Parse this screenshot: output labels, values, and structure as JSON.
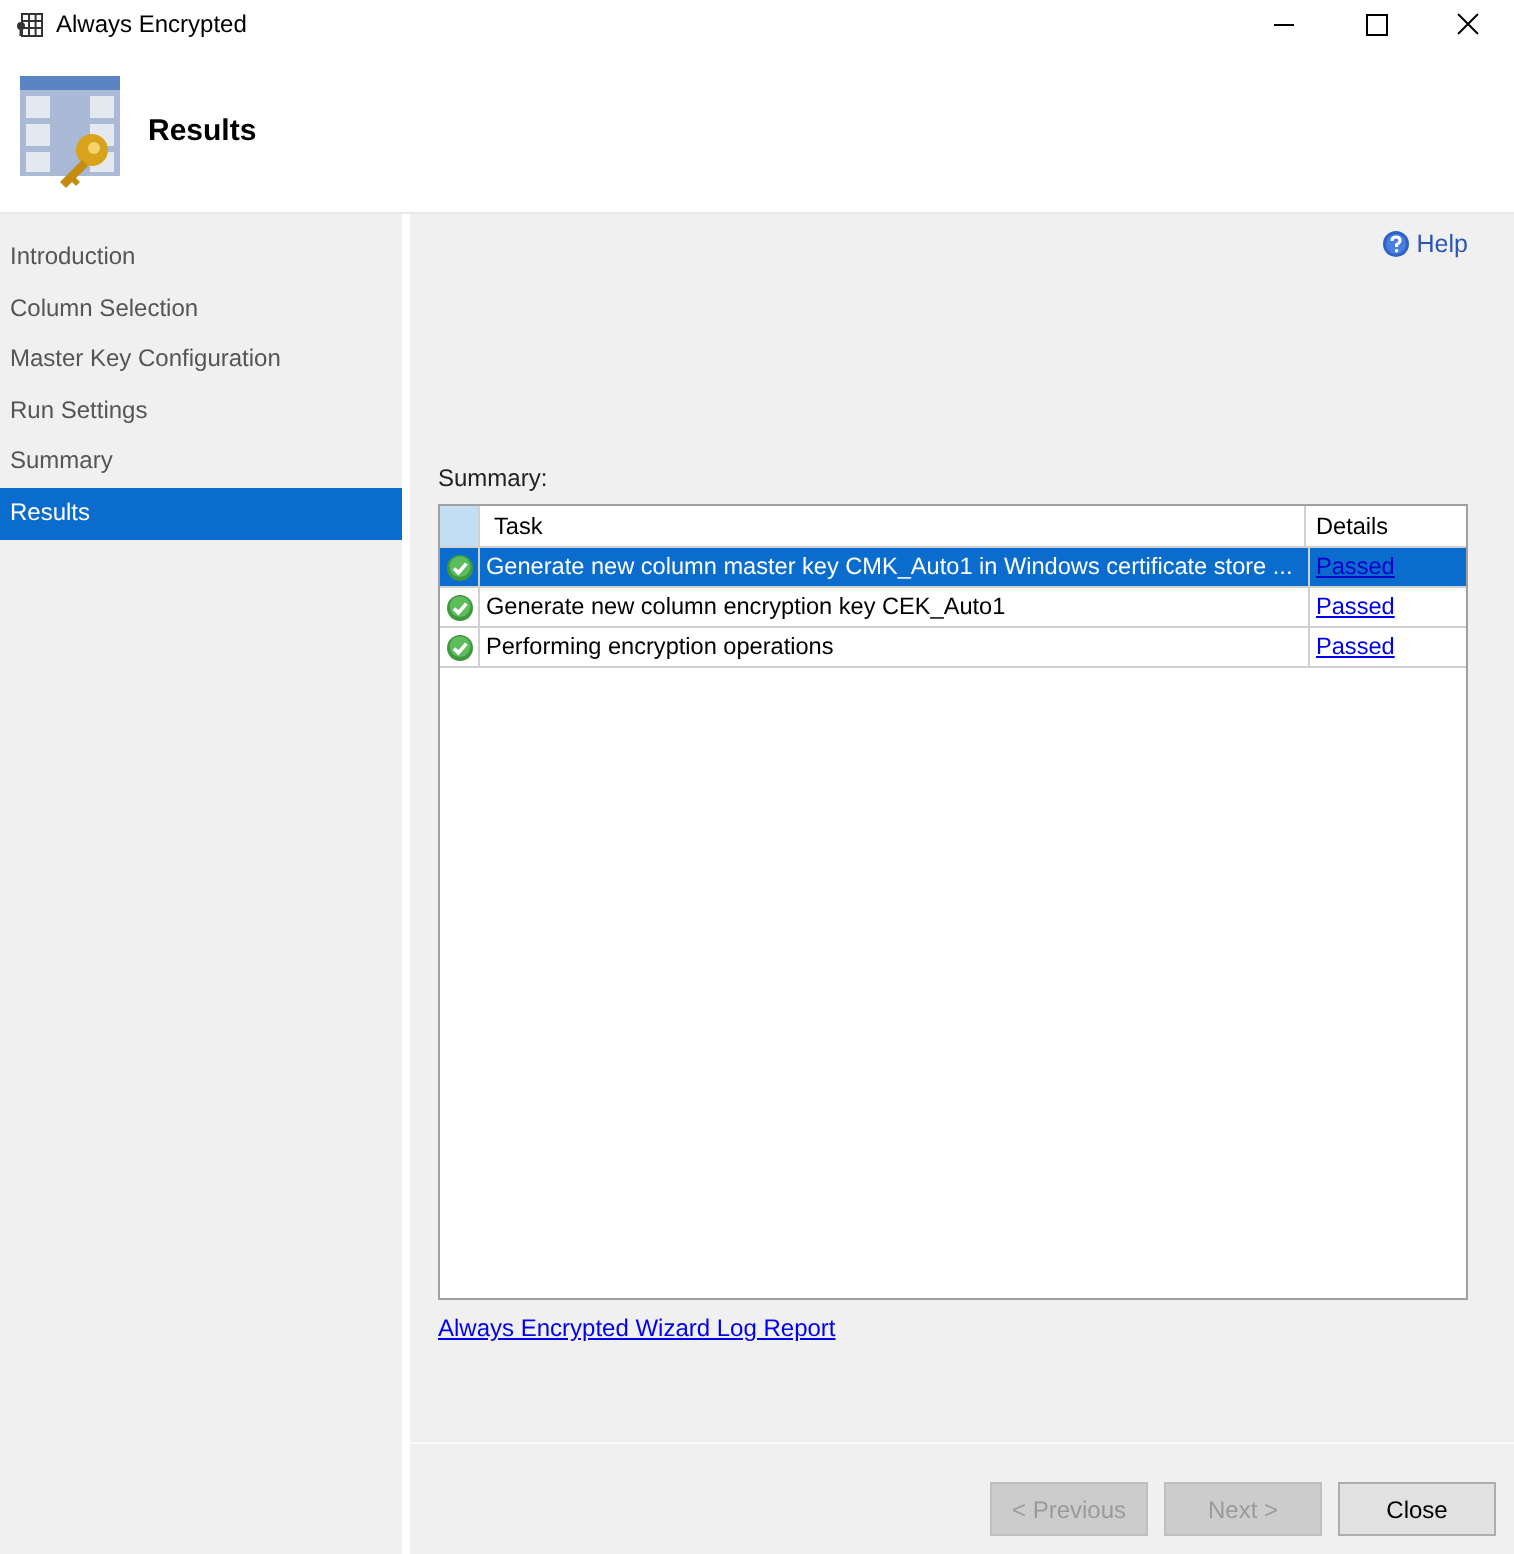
{
  "window": {
    "title": "Always Encrypted"
  },
  "header": {
    "title": "Results"
  },
  "sidebar": {
    "items": [
      {
        "label": "Introduction",
        "selected": false
      },
      {
        "label": "Column Selection",
        "selected": false
      },
      {
        "label": "Master Key Configuration",
        "selected": false
      },
      {
        "label": "Run Settings",
        "selected": false
      },
      {
        "label": "Summary",
        "selected": false
      },
      {
        "label": "Results",
        "selected": true
      }
    ]
  },
  "help": "Help",
  "summary_label": "Summary:",
  "table": {
    "columns": [
      "Task",
      "Details"
    ],
    "rows": [
      {
        "kind": "success",
        "task": "Generate new column master key CMK_Auto1 in Windows certificate store ...",
        "details": "Passed",
        "selected": true
      },
      {
        "kind": "success",
        "task": "Generate new column encryption key CEK_Auto1",
        "details": "Passed",
        "selected": false
      },
      {
        "kind": "success",
        "task": "Performing encryption operations",
        "details": "Passed",
        "selected": false
      }
    ]
  },
  "log_link": "Always Encrypted Wizard Log Report",
  "buttons": [
    {
      "label": "< Previous",
      "disabled": true
    },
    {
      "label": "Next >",
      "disabled": true
    },
    {
      "label": "Close",
      "disabled": false
    }
  ]
}
